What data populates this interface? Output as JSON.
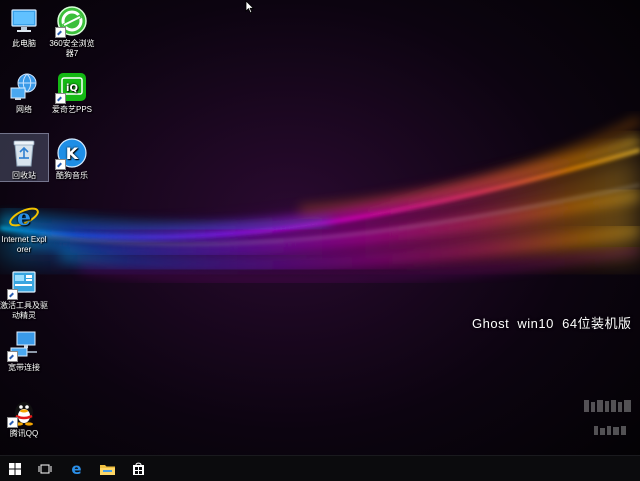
{
  "desktop": {
    "icons": {
      "this_pc": "此电脑",
      "browser_360": "360安全浏览器7",
      "network": "网络",
      "iqiyi": "爱奇艺PPS",
      "recycle_bin": "回收站",
      "kugou": "酷狗音乐",
      "ie": "Internet Explorer",
      "driver_tool": "激活工具及驱动精灵",
      "broadband": "宽带连接",
      "qq": "腾讯QQ"
    },
    "branding": "Ghost  win10  64位装机版"
  },
  "taskbar": {
    "start_icon": "windows-logo",
    "task_view_icon": "task-view",
    "edge_icon": "edge",
    "explorer_icon": "folder",
    "store_icon": "store"
  },
  "colors": {
    "taskbar": "#0b0b0d",
    "accent_orange": "#ff9a00",
    "accent_magenta": "#d400d4",
    "accent_blue": "#1a6cff"
  }
}
